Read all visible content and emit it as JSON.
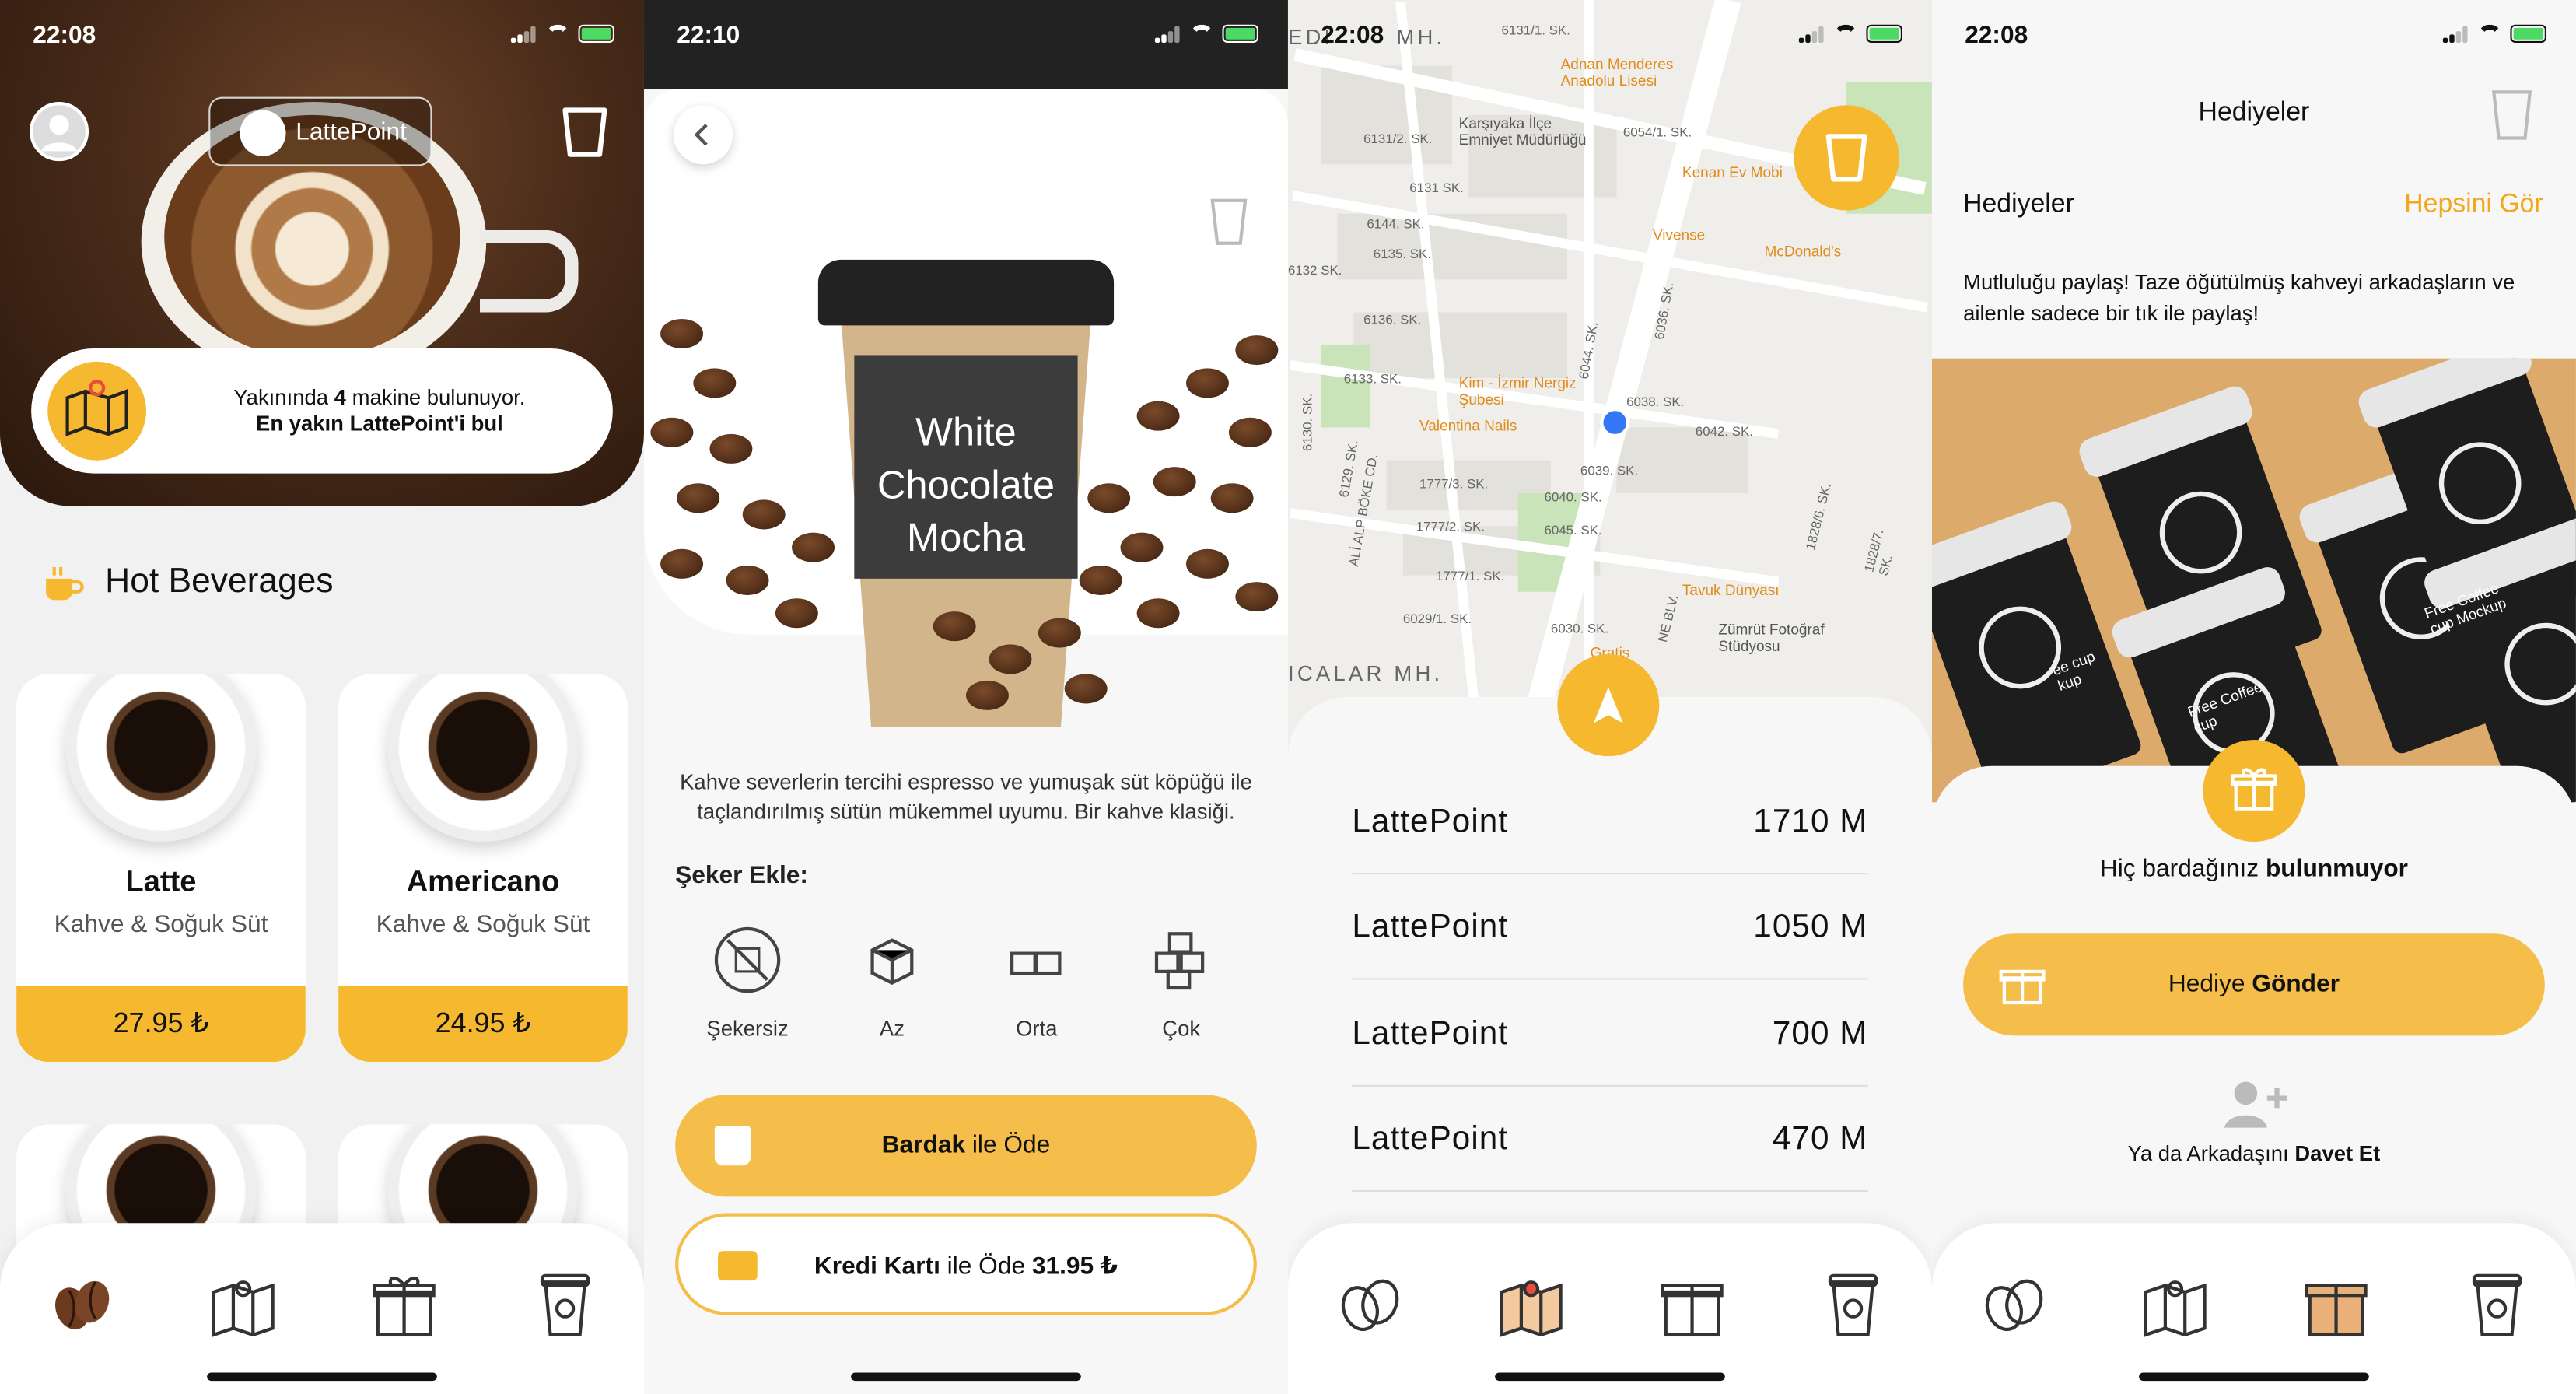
{
  "status": {
    "s1_time": "22:08",
    "s2_time": "22:10",
    "s3_time": "22:08",
    "s4_time": "22:08"
  },
  "screen1": {
    "brand": "LattePoint",
    "nearby_prefix": "Yakınında ",
    "nearby_count": "4",
    "nearby_suffix": " makine bulunuyor.",
    "nearest_cta": "En yakın LattePoint'i bul",
    "section_title": "Hot Beverages",
    "products": [
      {
        "name": "Latte",
        "subtitle": "Kahve & Soğuk Süt",
        "price": "27.95 ₺"
      },
      {
        "name": "Americano",
        "subtitle": "Kahve & Soğuk Süt",
        "price": "24.95 ₺"
      }
    ]
  },
  "screen2": {
    "product_name_line1": "White",
    "product_name_line2": "Chocolate",
    "product_name_line3": "Mocha",
    "description": "Kahve severlerin tercihi espresso ve yumuşak süt köpüğü ile taçlandırılmış sütün mükemmel uyumu. Bir kahve klasiği.",
    "sugar_title": "Şeker Ekle:",
    "sugar_options": [
      "Şekersiz",
      "Az",
      "Orta",
      "Çok"
    ],
    "pay_cup_bold": "Bardak",
    "pay_cup_rest": " ile Öde",
    "pay_card_bold": "Kredi Kartı",
    "pay_card_rest": " ile Öde ",
    "pay_card_price": "31.95 ₺"
  },
  "screen3": {
    "map_labels": [
      "Adnan Menderes Anadolu Lisesi",
      "Karşıyaka İlçe Emniyet Müdürlüğü",
      "Kenan Ev Mobi",
      "Vivense",
      "McDonald's",
      "Kim - İzmir Nergiz Şubesi",
      "Valentina Nails",
      "Tavuk Dünyası",
      "Zümrüt Fotoğraf Stüdyosu",
      "Gratis",
      "ICALAR MH.",
      "6131/1. SK.",
      "6054/1. SK.",
      "6131/2. SK.",
      "6131 SK.",
      "6132 SK.",
      "6144. SK.",
      "6135. SK.",
      "6136. SK.",
      "6133. SK.",
      "6130. SK.",
      "6038. SK.",
      "6042. SK.",
      "6039. SK.",
      "6040. SK.",
      "6045. SK.",
      "1777/3. SK.",
      "1777/2. SK.",
      "1777/1. SK.",
      "6029/1. SK.",
      "6030. SK.",
      "6044. SK.",
      "6036. SK.",
      "6129. SK.",
      "ALİ ALP BÖKE CD.",
      "1828/6. SK.",
      "1828/7. SK.",
      "NE BLV.",
      "EDİ",
      "MH."
    ],
    "locations": [
      {
        "name": "LattePoint",
        "distance": "1710 M"
      },
      {
        "name": "LattePoint",
        "distance": "1050 M"
      },
      {
        "name": "LattePoint",
        "distance": "700 M"
      },
      {
        "name": "LattePoint",
        "distance": "470 M"
      }
    ]
  },
  "screen4": {
    "header": "Hediyeler",
    "gifts_title": "Hediyeler",
    "see_all": "Hepsini Gör",
    "gift_desc": "Mutluluğu paylaş! Taze öğütülmüş kahveyi arkadaşların ve ailenle sadece bir tık ile paylaş!",
    "promo_texts": [
      "Free Coffee cup Mockup",
      "Free Coffee cup",
      "ee cup kup"
    ],
    "no_cup_prefix": "Hiç bardağınız ",
    "no_cup_bold": "bulunmuyor",
    "send_gift_prefix": "Hediye ",
    "send_gift_bold": "Gönder",
    "invite_prefix": "Ya da Arkadaşını ",
    "invite_bold": "Davet Et"
  },
  "colors": {
    "accent": "#f5b82e",
    "accent_text": "#f1a81c",
    "dark": "#111111"
  }
}
